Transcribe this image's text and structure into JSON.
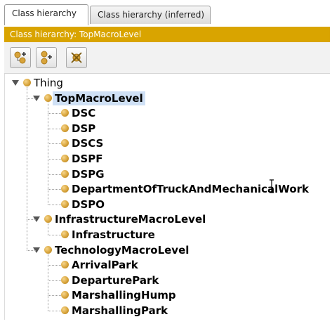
{
  "tabs": [
    {
      "label": "Class hierarchy",
      "active": true
    },
    {
      "label": "Class hierarchy (inferred)",
      "active": false
    }
  ],
  "panel_title": "Class hierarchy: TopMacroLevel",
  "toolbar": {
    "buttons": [
      {
        "icon": "add-subclass-icon"
      },
      {
        "icon": "add-sibling-class-icon"
      },
      {
        "icon": "delete-class-icon"
      }
    ]
  },
  "colors": {
    "title_bar": "#d9a400",
    "class_dot": "#d8a43b",
    "selection": "#cfe0f5"
  },
  "tree": {
    "root": "Thing",
    "groups": [
      {
        "label": "TopMacroLevel",
        "selected": true,
        "children": [
          "DSC",
          "DSP",
          "DSCS",
          "DSPF",
          "DSPG",
          "DepartmentOfTruckAndMechanicalWork",
          "DSPO"
        ]
      },
      {
        "label": "InfrastructureMacroLevel",
        "selected": false,
        "children": [
          "Infrastructure"
        ]
      },
      {
        "label": "TechnologyMacroLevel",
        "selected": false,
        "children": [
          "ArrivalPark",
          "DeparturePark",
          "MarshallingHump",
          "MarshallingPark"
        ]
      }
    ]
  }
}
